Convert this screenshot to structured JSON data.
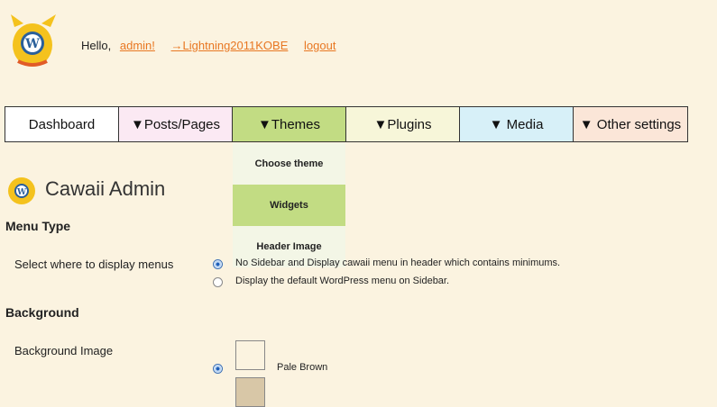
{
  "header": {
    "hello": "Hello,",
    "user_link": "admin!",
    "site_link": "→Lightning2011KOBE",
    "logout": "logout"
  },
  "menu": {
    "items": [
      {
        "label": "Dashboard"
      },
      {
        "label": "▼Posts/Pages"
      },
      {
        "label": "▼Themes"
      },
      {
        "label": "▼Plugins"
      },
      {
        "label": "▼ Media"
      },
      {
        "label": "▼ Other settings"
      }
    ],
    "dropdown": [
      {
        "label": "Choose theme"
      },
      {
        "label": "Widgets"
      },
      {
        "label": "Header Image"
      }
    ]
  },
  "page": {
    "title": "Cawaii Admin",
    "menu_type": {
      "heading": "Menu Type",
      "label": "Select where to display menus",
      "option1": "No Sidebar and Display cawaii menu in header which contains minimums.",
      "option2": "Display the default WordPress menu on Sidebar."
    },
    "background": {
      "heading": "Background",
      "label": "Background Image",
      "option1": "Pale Brown"
    }
  },
  "colors": {
    "page_bg": "#fbf3e0",
    "themes_menu": "#c2dc83",
    "link": "#e87722"
  }
}
